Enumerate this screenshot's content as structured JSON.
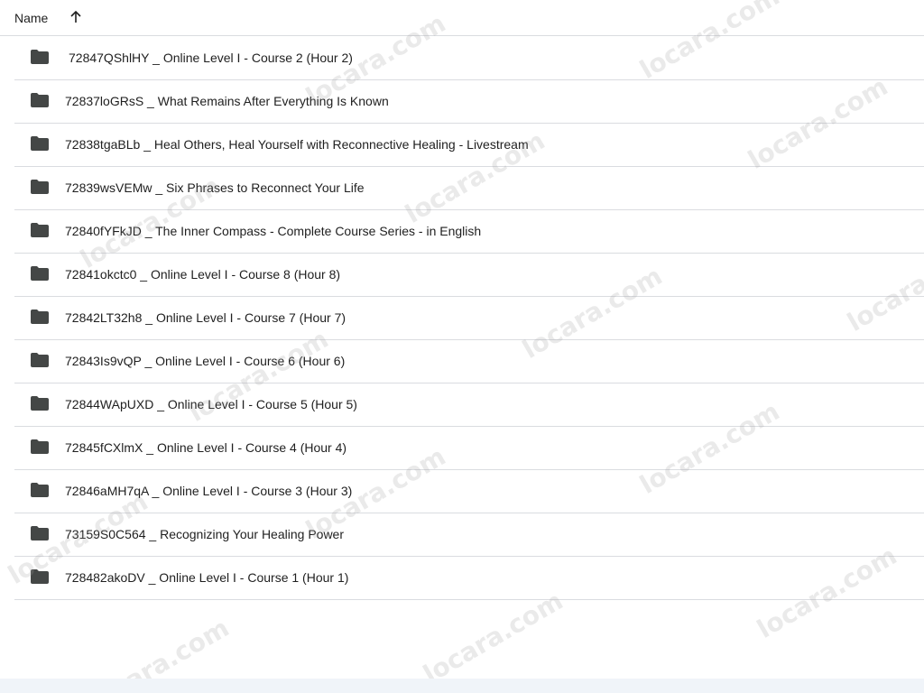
{
  "header": {
    "name_label": "Name",
    "sort_icon": "arrow-up-icon"
  },
  "rows": [
    {
      "label": "72847QShlHY _ Online Level I - Course 2 (Hour 2)",
      "icon": "folder-icon"
    },
    {
      "label": "72837loGRsS _ What Remains After Everything Is Known",
      "icon": "folder-icon"
    },
    {
      "label": "72838tgaBLb _ Heal Others, Heal Yourself with Reconnective Healing - Livestream",
      "icon": "folder-icon"
    },
    {
      "label": "72839wsVEMw _ Six Phrases to Reconnect Your Life",
      "icon": "folder-icon"
    },
    {
      "label": "72840fYFkJD _ The Inner Compass - Complete Course Series - in English",
      "icon": "folder-icon"
    },
    {
      "label": "72841okctc0 _ Online Level I - Course 8 (Hour 8)",
      "icon": "folder-icon"
    },
    {
      "label": "72842LT32h8 _ Online Level I - Course 7 (Hour 7)",
      "icon": "folder-icon"
    },
    {
      "label": "72843Is9vQP _ Online Level I - Course 6 (Hour 6)",
      "icon": "folder-icon"
    },
    {
      "label": "72844WApUXD _ Online Level I - Course 5 (Hour 5)",
      "icon": "folder-icon"
    },
    {
      "label": "72845fCXlmX _ Online Level I - Course 4 (Hour 4)",
      "icon": "folder-icon"
    },
    {
      "label": "72846aMH7qA _ Online Level I - Course 3 (Hour 3)",
      "icon": "folder-icon"
    },
    {
      "label": "73159S0C564 _ Recognizing Your Healing Power",
      "icon": "folder-icon"
    },
    {
      "label": "728482akoDV _ Online Level I - Course 1 (Hour 1)",
      "icon": "folder-icon"
    }
  ],
  "watermark_text": "locara.com",
  "colors": {
    "text": "#1f1f1f",
    "folder": "#444746",
    "divider": "#dadce0",
    "bottom_bar": "#f0f4f9"
  }
}
